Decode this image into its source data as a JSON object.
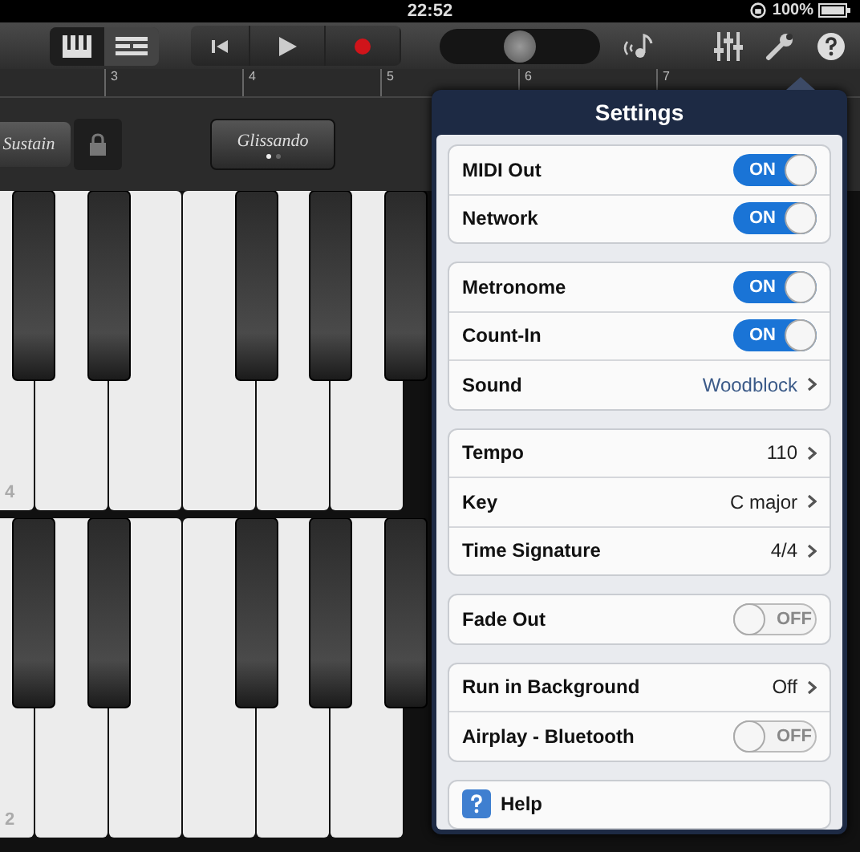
{
  "status_bar": {
    "time": "22:52",
    "battery": "100%"
  },
  "toolbar": {
    "view_tabs": [
      {
        "kind": "keys",
        "selected": true
      },
      {
        "kind": "tracks",
        "selected": false
      }
    ],
    "volume": {
      "level": 0.5
    }
  },
  "ruler": {
    "marks": [
      "3",
      "4",
      "5",
      "6",
      "7"
    ]
  },
  "controls": {
    "sustain": "Sustain",
    "glissando": "Glissando",
    "glissando_dots": [
      {
        "selected": true
      },
      {
        "selected": false
      }
    ]
  },
  "keyboards": [
    {
      "octave": "4"
    },
    {
      "octave": "2"
    }
  ],
  "settings": {
    "title": "Settings",
    "groups": [
      [
        {
          "kind": "toggle",
          "label": "MIDI Out",
          "on": true,
          "switch_text": "ON"
        },
        {
          "kind": "toggle",
          "label": "Network",
          "on": true,
          "switch_text": "ON"
        }
      ],
      [
        {
          "kind": "toggle",
          "label": "Metronome",
          "on": true,
          "switch_text": "ON"
        },
        {
          "kind": "toggle",
          "label": "Count-In",
          "on": true,
          "switch_text": "ON"
        },
        {
          "kind": "value",
          "label": "Sound",
          "value": "Woodblock",
          "blue": true
        }
      ],
      [
        {
          "kind": "value",
          "label": "Tempo",
          "value": "110",
          "blue": false
        },
        {
          "kind": "value",
          "label": "Key",
          "value": "C major",
          "blue": false
        },
        {
          "kind": "value",
          "label": "Time Signature",
          "value": "4/4",
          "blue": false
        }
      ],
      [
        {
          "kind": "toggle",
          "label": "Fade Out",
          "on": false,
          "switch_text": "OFF"
        }
      ],
      [
        {
          "kind": "value",
          "label": "Run in Background",
          "value": "Off",
          "blue": false
        },
        {
          "kind": "toggle",
          "label": "Airplay - Bluetooth",
          "on": false,
          "switch_text": "OFF"
        }
      ],
      [
        {
          "kind": "help",
          "label": "Help"
        }
      ]
    ]
  }
}
